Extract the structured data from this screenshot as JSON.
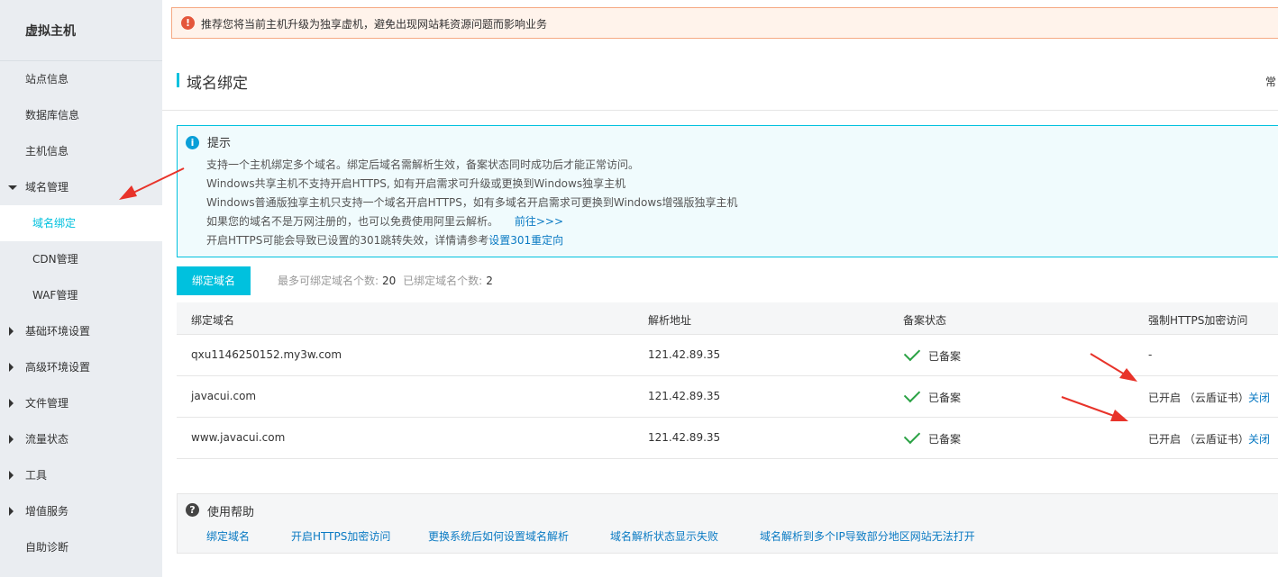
{
  "sidebar": {
    "title": "虚拟主机",
    "items": [
      {
        "label": "站点信息"
      },
      {
        "label": "数据库信息"
      },
      {
        "label": "主机信息"
      },
      {
        "label": "域名管理"
      },
      {
        "label": "域名绑定"
      },
      {
        "label": "CDN管理"
      },
      {
        "label": "WAF管理"
      },
      {
        "label": "基础环境设置"
      },
      {
        "label": "高级环境设置"
      },
      {
        "label": "文件管理"
      },
      {
        "label": "流量状态"
      },
      {
        "label": "工具"
      },
      {
        "label": "增值服务"
      },
      {
        "label": "自助诊断"
      }
    ]
  },
  "alert": {
    "icon": "warning-icon",
    "text": "推荐您将当前主机升级为独享虚机，避免出现网站耗资源问题而影响业务"
  },
  "page": {
    "title": "域名绑定",
    "right_cut": "常"
  },
  "tip": {
    "title": "提示",
    "lines": [
      "支持一个主机绑定多个域名。绑定后域名需解析生效，备案状态同时成功后才能正常访问。",
      "Windows共享主机不支持开启HTTPS, 如有开启需求可升级或更换到Windows独享主机",
      "Windows普通版独享主机只支持一个域名开启HTTPS，如有多域名开启需求可更换到Windows增强版独享主机",
      "如果您的域名不是万网注册的，也可以免费使用阿里云解析。",
      "开启HTTPS可能会导致已设置的301跳转失效，详情请参考"
    ],
    "link_goto": "前往>>>",
    "link_301": "设置301重定向"
  },
  "toolbar": {
    "bind_button": "绑定域名",
    "max_label": "最多可绑定域名个数:",
    "max_value": "20",
    "bound_label": "已绑定域名个数:",
    "bound_value": "2"
  },
  "table": {
    "headers": [
      "绑定域名",
      "解析地址",
      "备案状态",
      "强制HTTPS加密访问"
    ],
    "rows": [
      {
        "domain": "qxu1146250152.my3w.com",
        "ip": "121.42.89.35",
        "status": "已备案",
        "https": "-",
        "action": ""
      },
      {
        "domain": "javacui.com",
        "ip": "121.42.89.35",
        "status": "已备案",
        "https": "已开启 （云盾证书）",
        "action": "关闭"
      },
      {
        "domain": "www.javacui.com",
        "ip": "121.42.89.35",
        "status": "已备案",
        "https": "已开启 （云盾证书）",
        "action": "关闭"
      }
    ]
  },
  "help": {
    "title": "使用帮助",
    "links": [
      "绑定域名",
      "开启HTTPS加密访问",
      "更换系统后如何设置域名解析",
      "域名解析状态显示失败",
      "域名解析到多个IP导致部分地区网站无法打开"
    ]
  },
  "colors": {
    "accent": "#00c1de",
    "link": "#0a7ac3",
    "success": "#2ba245",
    "arrow": "#e8332a"
  }
}
